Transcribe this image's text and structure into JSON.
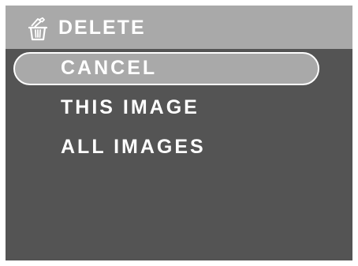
{
  "header": {
    "title": "DELETE",
    "icon": "trash-delete-icon"
  },
  "menu": {
    "items": [
      {
        "label": "CANCEL",
        "selected": true
      },
      {
        "label": "THIS IMAGE",
        "selected": false
      },
      {
        "label": "ALL IMAGES",
        "selected": false
      }
    ]
  },
  "colors": {
    "background": "#545454",
    "header": "#a9a9a9",
    "highlight": "#a9a9a9",
    "text": "#ffffff"
  }
}
